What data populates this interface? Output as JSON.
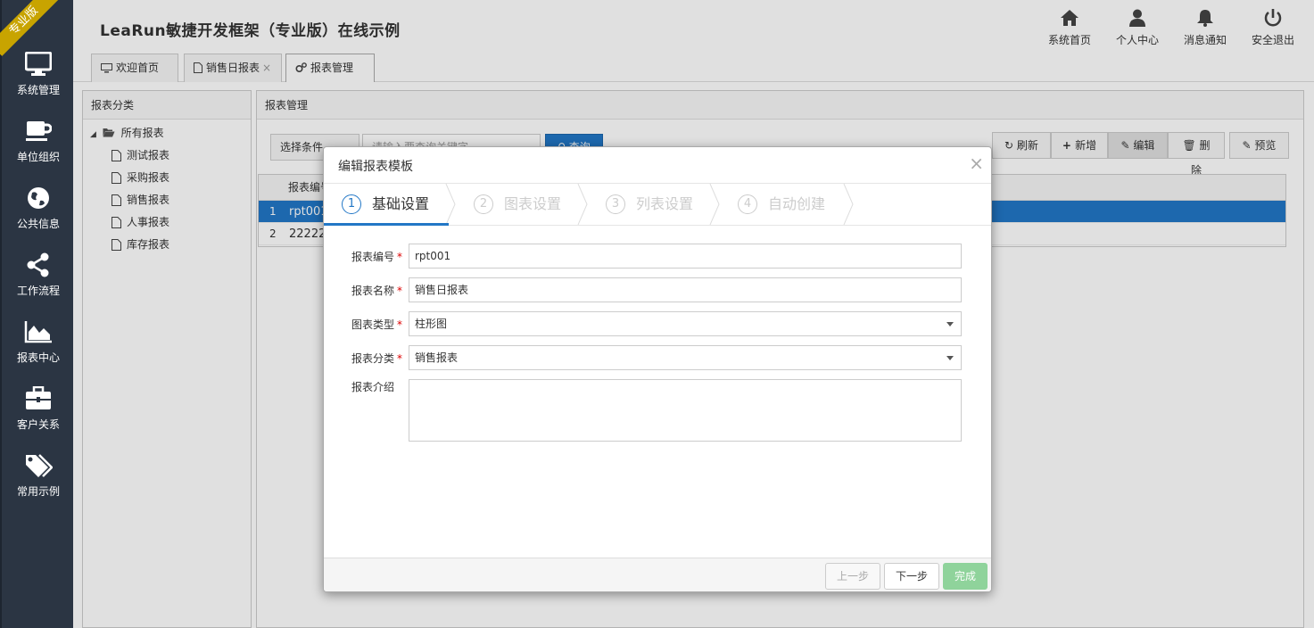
{
  "sidebar": {
    "edition_badge": "专业版",
    "items": [
      {
        "label": "系统管理",
        "icon": "monitor-icon"
      },
      {
        "label": "单位组织",
        "icon": "coffee-cup-icon"
      },
      {
        "label": "公共信息",
        "icon": "globe-icon"
      },
      {
        "label": "工作流程",
        "icon": "share-icon"
      },
      {
        "label": "报表中心",
        "icon": "area-chart-icon"
      },
      {
        "label": "客户关系",
        "icon": "briefcase-icon"
      },
      {
        "label": "常用示例",
        "icon": "tags-icon"
      }
    ]
  },
  "header": {
    "title": "LeaRun敏捷开发框架（专业版）在线示例",
    "actions": [
      {
        "label": "系统首页",
        "icon": "home-icon"
      },
      {
        "label": "个人中心",
        "icon": "user-icon"
      },
      {
        "label": "消息通知",
        "icon": "bell-icon"
      },
      {
        "label": "安全退出",
        "icon": "power-icon"
      }
    ],
    "tabs": [
      {
        "label": "欢迎首页",
        "icon": "desktop-icon"
      },
      {
        "label": "销售日报表",
        "icon": "file-icon",
        "close": "×"
      },
      {
        "label": "报表管理",
        "icon": "cogs-icon",
        "close": "×"
      }
    ]
  },
  "left_panel": {
    "title": "报表分类",
    "root": "所有报表",
    "items": [
      "测试报表",
      "采购报表",
      "销售报表",
      "人事报表",
      "库存报表"
    ]
  },
  "main_panel": {
    "title": "报表管理",
    "filter_label": "选择条件",
    "search_placeholder": "请输入要查询关键字",
    "search_button": "查询",
    "toolbar": {
      "refresh": "刷新",
      "add": "新增",
      "edit": "编辑",
      "delete": "删除",
      "preview": "预览"
    },
    "grid": {
      "header": "报表编号",
      "rows": [
        {
          "num": "1",
          "code": "rpt001"
        },
        {
          "num": "2",
          "code": "22222"
        }
      ]
    }
  },
  "modal": {
    "title": "编辑报表模板",
    "close": "×",
    "steps": [
      {
        "num": "1",
        "label": "基础设置"
      },
      {
        "num": "2",
        "label": "图表设置"
      },
      {
        "num": "3",
        "label": "列表设置"
      },
      {
        "num": "4",
        "label": "自动创建"
      }
    ],
    "form": {
      "code": {
        "label": "报表编号",
        "value": "rpt001",
        "required": "*"
      },
      "name": {
        "label": "报表名称",
        "value": "销售日报表",
        "required": "*"
      },
      "chart_type": {
        "label": "图表类型",
        "value": "柱形图",
        "required": "*"
      },
      "category": {
        "label": "报表分类",
        "value": "销售报表",
        "required": "*"
      },
      "intro": {
        "label": "报表介绍",
        "value": ""
      }
    },
    "footer": {
      "prev": "上一步",
      "next": "下一步",
      "finish": "完成"
    }
  },
  "colors": {
    "sidebar_bg": "#2b3543",
    "accent": "#2277c6",
    "finish_button": "#8fd39b",
    "required": "#dd0000"
  }
}
